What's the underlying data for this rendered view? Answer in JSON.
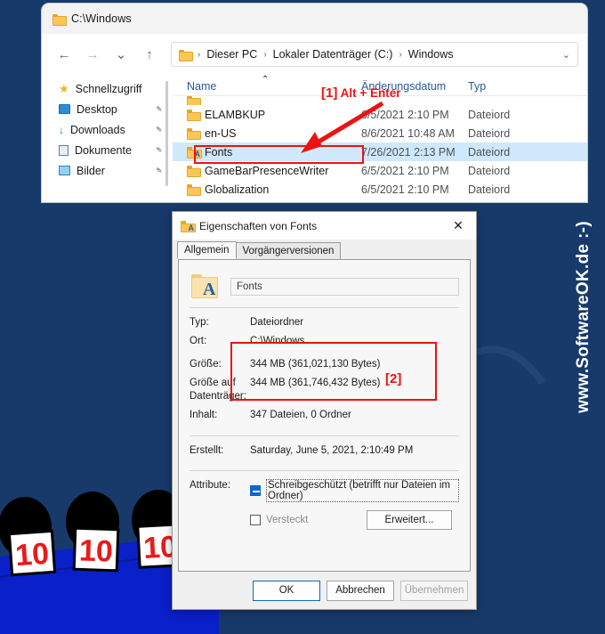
{
  "background": {
    "color": "#173a6b",
    "watermark": "www.SoftwareOK.de  :-)",
    "accent_red": "#ee1111"
  },
  "explorer": {
    "title": "C:\\Windows",
    "title_icon": "folder-icon",
    "nav": {
      "back": "←",
      "forward": "→",
      "recent": "⌄",
      "up": "↑"
    },
    "addressbar": {
      "icon": "folder-icon",
      "crumbs": [
        "Dieser PC",
        "Lokaler Datenträger (C:)",
        "Windows"
      ],
      "separator": "›",
      "chevron": "⌄"
    },
    "sidebar": {
      "items": [
        {
          "label": "Schnellzugriff",
          "icon": "star-icon",
          "pinned": false
        },
        {
          "label": "Desktop",
          "icon": "desktop-icon",
          "pinned": true
        },
        {
          "label": "Downloads",
          "icon": "download-icon",
          "pinned": true
        },
        {
          "label": "Dokumente",
          "icon": "documents-icon",
          "pinned": true
        },
        {
          "label": "Bilder",
          "icon": "pictures-icon",
          "pinned": true
        }
      ],
      "pin_glyph": "✒"
    },
    "list": {
      "columns": [
        "Name",
        "Änderungsdatum",
        "Typ"
      ],
      "sort_arrow": "⌃",
      "rows": [
        {
          "name": "",
          "date": "",
          "type": "",
          "selected": false,
          "partial": true,
          "icon": "folder-icon"
        },
        {
          "name": "ELAMBKUP",
          "date": "6/5/2021 2:10 PM",
          "type": "Dateiord",
          "selected": false,
          "partial": false,
          "icon": "folder-icon"
        },
        {
          "name": "en-US",
          "date": "8/6/2021 10:48 AM",
          "type": "Dateiord",
          "selected": false,
          "partial": false,
          "icon": "folder-icon"
        },
        {
          "name": "Fonts",
          "date": "7/26/2021 2:13 PM",
          "type": "Dateiord",
          "selected": true,
          "partial": false,
          "icon": "fonts-folder-icon"
        },
        {
          "name": "GameBarPresenceWriter",
          "date": "6/5/2021 2:10 PM",
          "type": "Dateiord",
          "selected": false,
          "partial": false,
          "icon": "folder-icon"
        },
        {
          "name": "Globalization",
          "date": "6/5/2021 2:10 PM",
          "type": "Dateiord",
          "selected": false,
          "partial": false,
          "icon": "folder-icon"
        }
      ]
    }
  },
  "annotations": {
    "step1_number": "[1]",
    "step1_text": "Alt + Enter",
    "step2_number": "[2]"
  },
  "dialog": {
    "title": "Eigenschaften von Fonts",
    "title_icon": "fonts-folder-icon",
    "close_glyph": "✕",
    "tabs": [
      {
        "label": "Allgemein",
        "active": true
      },
      {
        "label": "Vorgängerversionen",
        "active": false
      }
    ],
    "name_value": "Fonts",
    "fields": [
      {
        "label": "Typ:",
        "value": "Dateiordner"
      },
      {
        "label": "Ort:",
        "value": "C:\\Windows"
      },
      {
        "label": "Größe:",
        "value": "344 MB (361,021,130 Bytes)"
      },
      {
        "label": "Größe auf Datenträger:",
        "value": "344 MB (361,746,432 Bytes)"
      },
      {
        "label": "Inhalt:",
        "value": "347 Dateien, 0 Ordner"
      },
      {
        "label": "Erstellt:",
        "value": "Saturday, June 5, 2021, 2:10:49 PM"
      }
    ],
    "attributes": {
      "label": "Attribute:",
      "readonly_label": "Schreibgeschützt (betrifft nur Dateien im Ordner)",
      "readonly_state": "indeterminate",
      "hidden_label": "Versteckt",
      "hidden_state": "unchecked",
      "advanced_button": "Erweitert..."
    },
    "buttons": {
      "ok": "OK",
      "cancel": "Abbrechen",
      "apply": "Übernehmen"
    }
  }
}
